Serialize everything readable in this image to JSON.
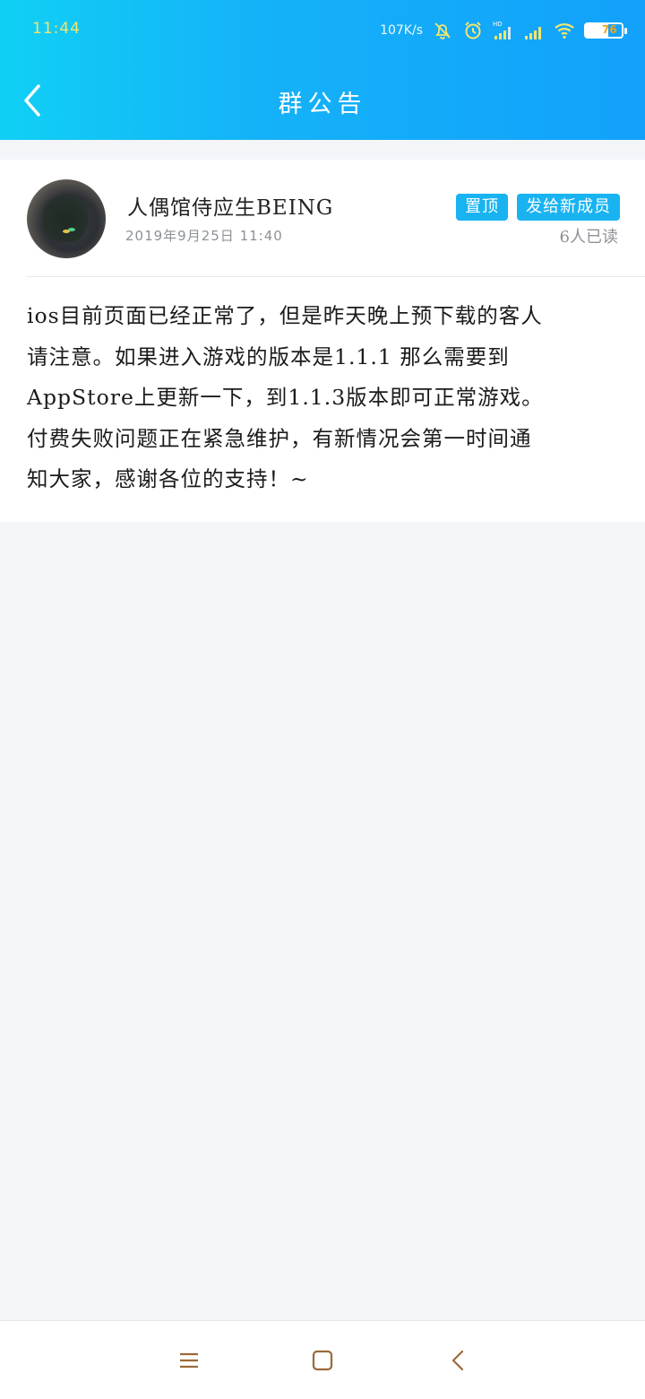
{
  "status_bar": {
    "time": "11:44",
    "net_speed": "107K/s",
    "battery": "76",
    "icons": [
      "mute-icon",
      "alarm-icon",
      "hd-signal-icon",
      "signal-icon",
      "wifi-icon",
      "battery-icon"
    ]
  },
  "nav": {
    "title": "群公告",
    "back_icon": "chevron-left-icon"
  },
  "post": {
    "author": "人偶馆侍应生BEING",
    "time": "2019年9月25日  11:40",
    "tags": [
      "置顶",
      "发给新成员"
    ],
    "read_count": "6人已读",
    "content_lines": [
      "ios目前页面已经正常了，但是昨天晚上预下载的客人",
      "请注意。如果进入游戏的版本是1.1.1 那么需要到",
      "AppStore上更新一下，到1.1.3版本即可正常游戏。",
      "付费失败问题正在紧急维护，有新情况会第一时间通",
      "知大家，感谢各位的支持！~"
    ]
  },
  "bottom_nav": {
    "icons": [
      "menu-icon",
      "home-icon",
      "back-icon"
    ]
  },
  "colors": {
    "header_start": "#10d0f5",
    "header_end": "#12a1fb",
    "tag_bg": "#19b3f1",
    "page_bg": "#f3f5f9"
  }
}
